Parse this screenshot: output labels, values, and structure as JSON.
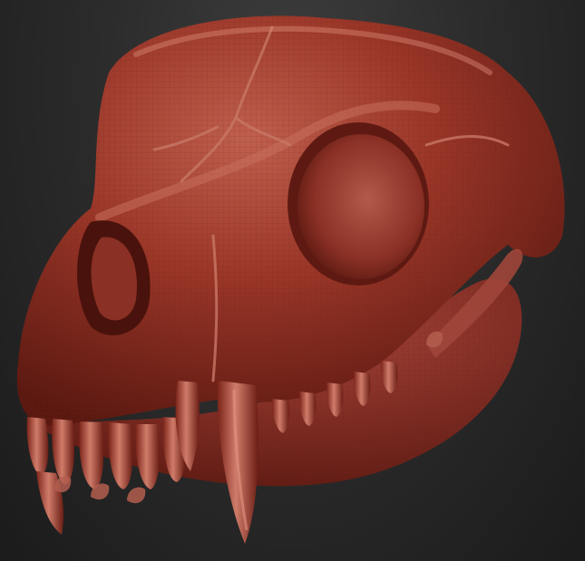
{
  "scene": {
    "subject": "sculpted-skull",
    "colors": {
      "background_top": "#3d3d3d",
      "background_bottom": "#1b1b1b",
      "clay_base": "#8e2e22",
      "clay_highlight": "#c86a58",
      "clay_shadow": "#4a120c",
      "wireframe": "#6f231a"
    }
  }
}
